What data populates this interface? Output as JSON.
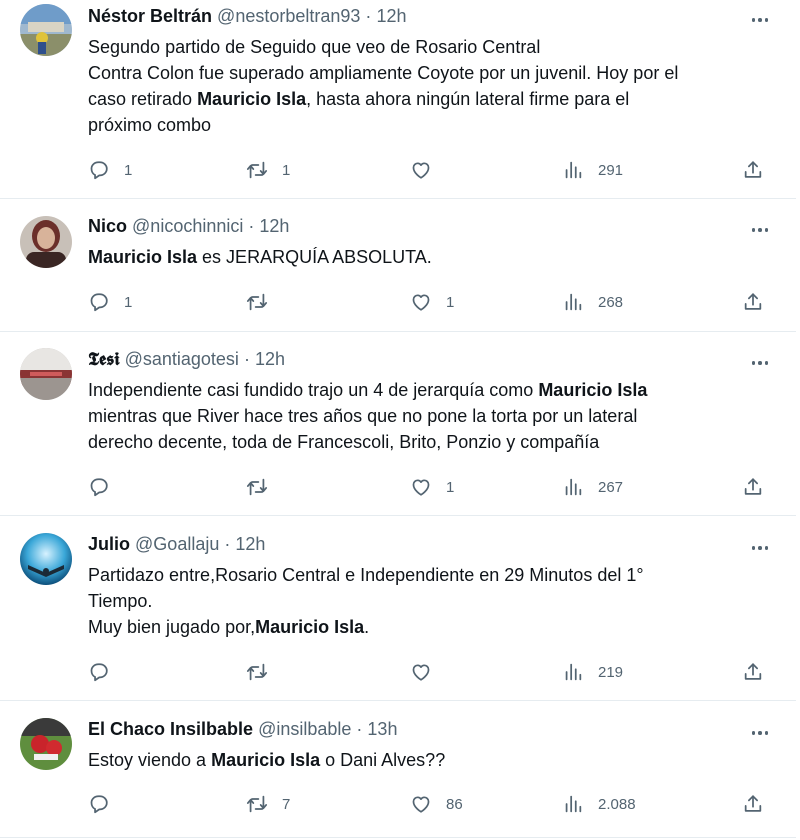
{
  "tweets": [
    {
      "name": "Néstor Beltrán",
      "handle": "@nestorbeltran93",
      "dot": "·",
      "time": "12h",
      "lines": [
        [
          "Segundo partido de Seguido que veo de Rosario Central"
        ],
        [
          "Contra Colon fue superado ampliamente Coyote por un juvenil. Hoy por el"
        ],
        [
          "caso retirado ",
          "Mauricio Isla",
          ", hasta ahora ningún lateral firme para el"
        ],
        [
          "próximo combo"
        ]
      ],
      "replies": "1",
      "retweets": "1",
      "likes": "",
      "views": "291"
    },
    {
      "name": "Nico",
      "handle": "@nicochinnici",
      "dot": "·",
      "time": "12h",
      "lines": [
        [
          "",
          "Mauricio Isla",
          " es JERARQUÍA ABSOLUTA."
        ]
      ],
      "replies": "1",
      "retweets": "",
      "likes": "1",
      "views": "268"
    },
    {
      "name": "𝕿𝖊𝖘𝖎",
      "handle": "@santiagotesi",
      "dot": "·",
      "time": "12h",
      "lines": [
        [
          "Independiente casi fundido trajo un 4 de jerarquía como ",
          "Mauricio Isla"
        ],
        [
          "mientras que River hace tres años que no pone la torta por un lateral"
        ],
        [
          "derecho decente, toda de Francescoli, Brito, Ponzio y compañía"
        ]
      ],
      "replies": "",
      "retweets": "",
      "likes": "1",
      "views": "267"
    },
    {
      "name": "Julio",
      "handle": "@Goallaju",
      "dot": "·",
      "time": "12h",
      "lines": [
        [
          "Partidazo entre,Rosario Central e Independiente en 29 Minutos del 1°"
        ],
        [
          "Tiempo."
        ],
        [
          "Muy bien jugado por,",
          "Mauricio Isla",
          "."
        ]
      ],
      "replies": "",
      "retweets": "",
      "likes": "",
      "views": "219"
    },
    {
      "name": "El Chaco Insilbable",
      "handle": "@insilbable",
      "dot": "·",
      "time": "13h",
      "lines": [
        [
          "Estoy viendo a ",
          "Mauricio Isla",
          " o Dani Alves??"
        ]
      ],
      "replies": "",
      "retweets": "7",
      "likes": "86",
      "views": "2.088"
    }
  ],
  "icons": {
    "reply": "reply-icon",
    "retweet": "retweet-icon",
    "like": "heart-icon",
    "views": "views-icon",
    "share": "share-icon",
    "more": "more-icon"
  },
  "colors": {
    "text": "#0f1419",
    "secondary": "#536471",
    "divider": "#e6ecf0"
  }
}
